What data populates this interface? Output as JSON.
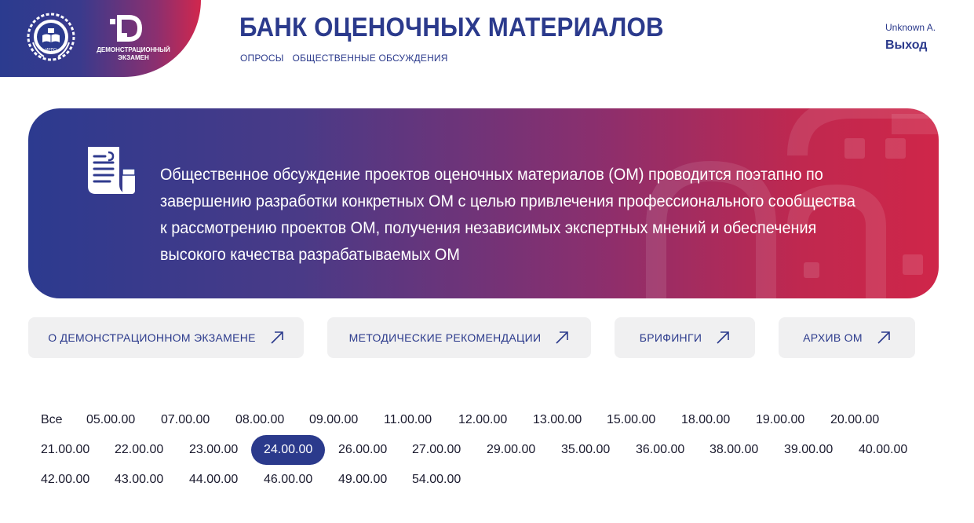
{
  "logo": {
    "emblem_text": "ИРПО",
    "de_caption_line1": "ДЕМОНСТРАЦИОННЫЙ",
    "de_caption_line2": "ЭКЗАМЕН"
  },
  "header": {
    "title": "БАНК ОЦЕНОЧНЫХ МАТЕРИАЛОВ",
    "nav": [
      {
        "label": "ОПРОСЫ"
      },
      {
        "label": "ОБЩЕСТВЕННЫЕ ОБСУЖДЕНИЯ"
      }
    ],
    "user_name": "Unknown A.",
    "logout_label": "Выход"
  },
  "banner": {
    "text": "Общественное обсуждение проектов оценочных материалов (ОМ) проводится поэтапно по завершению разработки конкретных ОМ с целью привлечения профессионального сообщества к рассмотрению проектов ОМ, получения независимых экспертных мнений и обеспечения высокого качества разрабатываемых ОМ"
  },
  "links": [
    {
      "label": "О ДЕМОНСТРАЦИОННОМ ЭКЗАМЕНЕ"
    },
    {
      "label": "МЕТОДИЧЕСКИЕ РЕКОМЕНДАЦИИ"
    },
    {
      "label": "БРИФИНГИ"
    },
    {
      "label": "АРХИВ ОМ"
    }
  ],
  "codes": {
    "selected": "24.00.00",
    "rows": [
      [
        "Все",
        "05.00.00",
        "07.00.00",
        "08.00.00",
        "09.00.00",
        "11.00.00",
        "12.00.00",
        "13.00.00",
        "15.00.00",
        "18.00.00",
        "19.00.00",
        "20.00.00"
      ],
      [
        "21.00.00",
        "22.00.00",
        "23.00.00",
        "24.00.00",
        "26.00.00",
        "27.00.00",
        "29.00.00",
        "35.00.00",
        "36.00.00",
        "38.00.00",
        "39.00.00",
        "40.00.00"
      ],
      [
        "42.00.00",
        "43.00.00",
        "44.00.00",
        "46.00.00",
        "49.00.00",
        "54.00.00"
      ]
    ]
  },
  "colors": {
    "brand_blue": "#2b3a8c",
    "brand_red": "#d1274d",
    "button_bg": "#f0f0f1"
  }
}
